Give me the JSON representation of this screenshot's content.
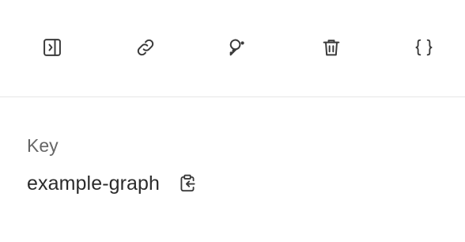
{
  "toolbar": {
    "buttons": [
      {
        "icon": "panel-right-icon"
      },
      {
        "icon": "link-icon"
      },
      {
        "icon": "key-icon"
      },
      {
        "icon": "trash-icon"
      },
      {
        "icon": "braces-icon"
      }
    ],
    "json_glyph": "{ }"
  },
  "details": {
    "label": "Key",
    "value": "example-graph",
    "copy_icon": "clipboard-copy-icon"
  },
  "colors": {
    "icon": "#3a3a3a",
    "label": "#666666",
    "value": "#2b2b2b",
    "divider": "#e7e7e7",
    "background": "#ffffff"
  }
}
